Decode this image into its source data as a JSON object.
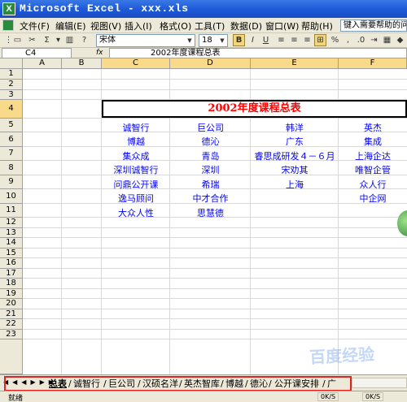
{
  "window": {
    "title": "Microsoft Excel - xxx.xls",
    "app_icon": "X"
  },
  "menu": {
    "items": [
      "文件(F)",
      "编辑(E)",
      "视图(V)",
      "插入(I)",
      "格式(O)",
      "工具(T)",
      "数据(D)",
      "窗口(W)",
      "帮助(H)"
    ],
    "help_placeholder": "键入需要帮助的问"
  },
  "toolbar": {
    "font": "宋体",
    "size": "18",
    "bold": "B",
    "italic": "I",
    "underline": "U"
  },
  "formula": {
    "name_box": "C4",
    "fx": "fx",
    "value": "2002年度课程总表"
  },
  "columns": [
    "A",
    "B",
    "C",
    "D",
    "E",
    "F"
  ],
  "rows": [
    "1",
    "2",
    "3",
    "4",
    "5",
    "6",
    "7",
    "8",
    "9",
    "10",
    "11",
    "12",
    "13",
    "14",
    "15",
    "16",
    "17",
    "18",
    "19",
    "20",
    "21",
    "22",
    "23"
  ],
  "sheet": {
    "title": "2002年度课程总表",
    "col_c": [
      "诚智行",
      "博越",
      "集众成",
      "深圳诚智行",
      "问鼎公开课",
      "逸马顾问",
      "大众人性"
    ],
    "col_d": [
      "巨公司",
      "德沁",
      "青岛",
      "深圳",
      "希瑞",
      "中才合作",
      "思慧德"
    ],
    "col_e": [
      "韩洋",
      "广东",
      "睿思成研发４－６月",
      "宋劝其",
      "上海"
    ],
    "col_f": [
      "英杰",
      "集成",
      "上海企达",
      "唯智企管",
      "众人行",
      "中企网"
    ]
  },
  "tabs": [
    "总表",
    "诚智行",
    "巨公司",
    "汉硕名洋",
    "英杰智库",
    "博越",
    "德沁",
    "公开课安排",
    "广"
  ],
  "active_tab": "总表",
  "status": {
    "ready": "就绪",
    "mode1": "0K/S",
    "mode2": "0K/S"
  },
  "watermark": "百度经验"
}
